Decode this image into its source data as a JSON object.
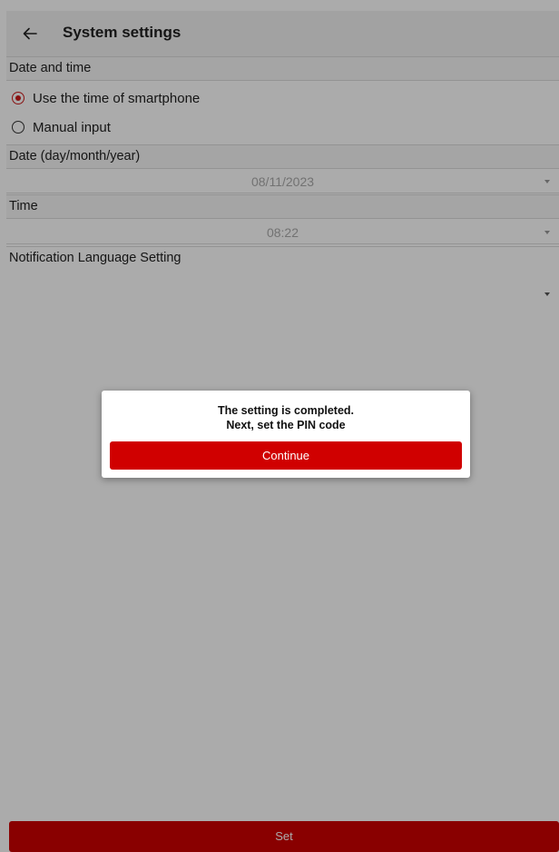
{
  "app_bar": {
    "title": "System settings",
    "back_icon": "arrow-left-icon"
  },
  "date_time_section": {
    "header": "Date and time",
    "options": [
      {
        "label": "Use the time of smartphone",
        "selected": true
      },
      {
        "label": "Manual input",
        "selected": false
      }
    ]
  },
  "date_section": {
    "header": "Date (day/month/year)",
    "value": "08/11/2023"
  },
  "time_section": {
    "header": "Time",
    "value": "08:22"
  },
  "language_section": {
    "header": "Notification Language Setting",
    "value": ""
  },
  "footer": {
    "set_label": "Set"
  },
  "dialog": {
    "line1": "The setting is completed.",
    "line2": "Next, set the PIN code",
    "continue_label": "Continue"
  },
  "colors": {
    "accent": "#cc0000",
    "radio_selected": "#cc1a1a",
    "overlay": "rgba(0,0,0,0.33)"
  }
}
